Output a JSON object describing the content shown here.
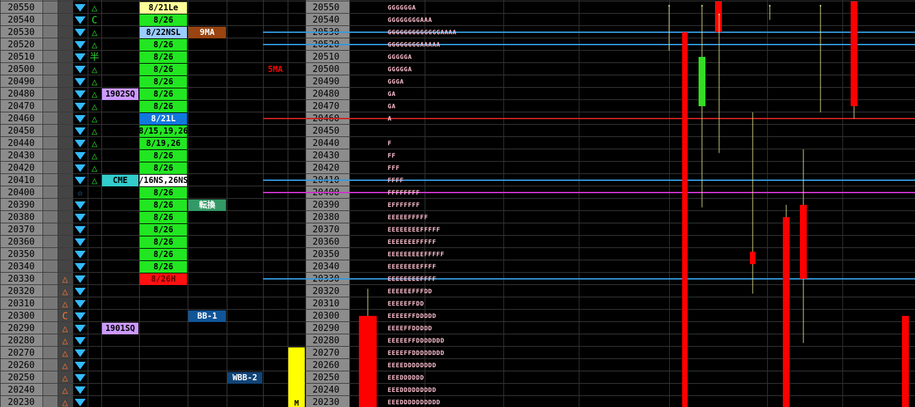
{
  "prices": [
    20550,
    20540,
    20530,
    20520,
    20510,
    20500,
    20490,
    20480,
    20470,
    20460,
    20450,
    20440,
    20430,
    20420,
    20410,
    20400,
    20390,
    20380,
    20370,
    20360,
    20350,
    20340,
    20330,
    20320,
    20310,
    20300,
    20290,
    20280,
    20270,
    20260,
    20250,
    20240,
    20230
  ],
  "colors": {
    "price_bg": "#8c8c8c",
    "price_text": "#000000",
    "grid": "#3a3a3a",
    "green_cell": "#22e622",
    "tpo_text": "#ffc0d0",
    "candle": "#ff0000",
    "candle_up": "#33dd22",
    "wick": "#dddd88",
    "down_arrow": "#33bbff",
    "up_triangle": "#33dd33",
    "orange": "#ff7733",
    "blue_line": "#3399dd",
    "red_line": "#cc2222",
    "magenta_line": "#cc33cc",
    "yellow_bar": "#ffff00"
  },
  "col_orange": {
    "20330": "△",
    "20320": "△",
    "20310": "△",
    "20300": "C",
    "20290": "△",
    "20280": "△",
    "20270": "△",
    "20260": "△",
    "20250": "△",
    "20240": "△",
    "20230": "△"
  },
  "col_green_marks": {
    "20550": "△",
    "20540": "C",
    "20530": "△",
    "20520": "△",
    "20510": "半",
    "20500": "△",
    "20490": "△",
    "20480": "△",
    "20470": "△",
    "20460": "△",
    "20450": "△",
    "20440": "△",
    "20430": "△",
    "20420": "△",
    "20410": "△"
  },
  "col_blue_marks": {
    "20400": "☆"
  },
  "labels_col4": [
    {
      "price": 20480,
      "text": "1902SQ",
      "bg": "#cc99ff",
      "fg": "#000000"
    },
    {
      "price": 20410,
      "text": "CME",
      "bg": "#33cccc",
      "fg": "#000000"
    },
    {
      "price": 20290,
      "text": "1901SQ",
      "bg": "#cc99ff",
      "fg": "#000000"
    }
  ],
  "dates_col5": [
    {
      "price": 20550,
      "text": "8/21Le",
      "bg": "#ffff99",
      "fg": "#000000"
    },
    {
      "price": 20540,
      "text": "8/26",
      "bg": "#22e622",
      "fg": "#000000"
    },
    {
      "price": 20530,
      "text": "8/22NSL",
      "bg": "#99ccff",
      "fg": "#000000"
    },
    {
      "price": 20520,
      "text": "8/26",
      "bg": "#22e622",
      "fg": "#000000"
    },
    {
      "price": 20510,
      "text": "8/26",
      "bg": "#22e622",
      "fg": "#000000"
    },
    {
      "price": 20500,
      "text": "8/26",
      "bg": "#22e622",
      "fg": "#000000"
    },
    {
      "price": 20490,
      "text": "8/26",
      "bg": "#22e622",
      "fg": "#000000"
    },
    {
      "price": 20480,
      "text": "8/26",
      "bg": "#22e622",
      "fg": "#000000"
    },
    {
      "price": 20470,
      "text": "8/26",
      "bg": "#22e622",
      "fg": "#000000"
    },
    {
      "price": 20460,
      "text": "8/21L",
      "bg": "#1177dd",
      "fg": "#ffffff"
    },
    {
      "price": 20450,
      "text": "8/15,19,26",
      "bg": "#22e622",
      "fg": "#000000"
    },
    {
      "price": 20440,
      "text": "8/19,26",
      "bg": "#22e622",
      "fg": "#000000"
    },
    {
      "price": 20430,
      "text": "8/26",
      "bg": "#22e622",
      "fg": "#000000"
    },
    {
      "price": 20420,
      "text": "8/26",
      "bg": "#22e622",
      "fg": "#000000"
    },
    {
      "price": 20410,
      "text": "/16NS,26NS",
      "bg": "#ffffff",
      "fg": "#000000"
    },
    {
      "price": 20400,
      "text": "8/26",
      "bg": "#22e622",
      "fg": "#000000"
    },
    {
      "price": 20390,
      "text": "8/26",
      "bg": "#22e622",
      "fg": "#000000"
    },
    {
      "price": 20380,
      "text": "8/26",
      "bg": "#22e622",
      "fg": "#000000"
    },
    {
      "price": 20370,
      "text": "8/26",
      "bg": "#22e622",
      "fg": "#000000"
    },
    {
      "price": 20360,
      "text": "8/26",
      "bg": "#22e622",
      "fg": "#000000"
    },
    {
      "price": 20350,
      "text": "8/26",
      "bg": "#22e622",
      "fg": "#000000"
    },
    {
      "price": 20340,
      "text": "8/26",
      "bg": "#22e622",
      "fg": "#000000"
    },
    {
      "price": 20330,
      "text": "8/26H",
      "bg": "#ff1111",
      "fg": "#660000"
    }
  ],
  "labels_col6": [
    {
      "price": 20530,
      "text": "9MA",
      "bg": "#994411",
      "fg": "#ffffff"
    },
    {
      "price": 20390,
      "text": "転換",
      "bg": "#339966",
      "fg": "#ffffff"
    },
    {
      "price": 20300,
      "text": "BB-1",
      "bg": "#115599",
      "fg": "#ffffff"
    }
  ],
  "labels_col7": [
    {
      "price": 20250,
      "text": "WBB-2",
      "bg": "#114477",
      "fg": "#ffffff"
    }
  ],
  "labels_col8": [
    {
      "price": 20500,
      "text": "5MA",
      "bg": "none",
      "fg": "#ff0000"
    }
  ],
  "yellow_bar": {
    "from": 20230,
    "to": 20270,
    "label": "M"
  },
  "tpo": {
    "20550": "GGGGGGA",
    "20540": "GGGGGGGGAAA",
    "20530": "GGGGGGGGGGGGGAAAA",
    "20520": "GGGGGGGGAAAAA",
    "20510": "GGGGGA",
    "20500": "GGGGGA",
    "20490": "GGGA",
    "20480": "GA",
    "20470": "GA",
    "20460": "A",
    "20450": "",
    "20440": "F",
    "20430": "FF",
    "20420": "FFF",
    "20410": "FFFF",
    "20400": "FFFFFFFF",
    "20390": "EFFFFFFF",
    "20380": "EEEEEFFFFF",
    "20370": "EEEEEEEEFFFFF",
    "20360": "EEEEEEEFFFFF",
    "20350": "EEEEEEEEEFFFFF",
    "20340": "EEEEEEEEFFFF",
    "20330": "EEEEEEEEFFFF",
    "20320": "EEEEEEFFFDD",
    "20310": "EEEEEFFDD",
    "20300": "EEEEEFFDDDDD",
    "20290": "EEEEFFDDDDD",
    "20280": "EEEEEFFDDDDDDD",
    "20270": "EEEEFFDDDDDDDD",
    "20260": "EEEEDDDDDDDD",
    "20250": "EEEDDDDDD",
    "20240": "EEEDDDDDDDDD",
    "20230": "EEEDDDDDDDDDD"
  },
  "hlines": [
    {
      "price": 20530,
      "color": "#3399dd"
    },
    {
      "price": 20520,
      "color": "#3399dd"
    },
    {
      "price": 20460,
      "color": "#cc2222"
    },
    {
      "price": 20410,
      "color": "#3399dd"
    },
    {
      "price": 20400,
      "color": "#cc33cc"
    },
    {
      "price": 20330,
      "color": "#3399dd"
    }
  ],
  "chart_data": {
    "type": "candlestick",
    "candles": [
      {
        "open": 20300,
        "close": 20225,
        "high": 20322,
        "low": 20225,
        "color": "#ff0000"
      },
      {
        "open": 20552,
        "close": 20552,
        "high": 20552,
        "low": 20515,
        "color": "#dddd88"
      },
      {
        "open": 20530,
        "close": 20225,
        "high": 20530,
        "low": 20225,
        "color": "#ff0000"
      },
      {
        "open": 20552,
        "close": 20552,
        "high": 20552,
        "low": 20398,
        "color": "#dddd88"
      },
      {
        "open": 20510,
        "close": 20470,
        "high": 20545,
        "low": 20388,
        "color": "#33dd22"
      },
      {
        "open": 20555,
        "close": 20530,
        "high": 20555,
        "low": 20530,
        "color": "#ff0000"
      },
      {
        "open": 20545,
        "close": 20545,
        "high": 20545,
        "low": 20432,
        "color": "#dddd88"
      },
      {
        "open": 20352,
        "close": 20342,
        "high": 20465,
        "low": 20318,
        "color": "#ff0000"
      },
      {
        "open": 20552,
        "close": 20552,
        "high": 20552,
        "low": 20540,
        "color": "#dddd88"
      },
      {
        "open": 20380,
        "close": 20225,
        "high": 20390,
        "low": 20225,
        "color": "#ff0000"
      },
      {
        "open": 20390,
        "close": 20330,
        "high": 20435,
        "low": 20278,
        "color": "#ff0000"
      },
      {
        "open": 20552,
        "close": 20552,
        "high": 20552,
        "low": 20465,
        "color": "#dddd88"
      },
      {
        "open": 20555,
        "close": 20470,
        "high": 20555,
        "low": 20460,
        "color": "#ff0000"
      },
      {
        "open": 20300,
        "close": 20225,
        "high": 20300,
        "low": 20225,
        "color": "#ff0000"
      }
    ]
  }
}
